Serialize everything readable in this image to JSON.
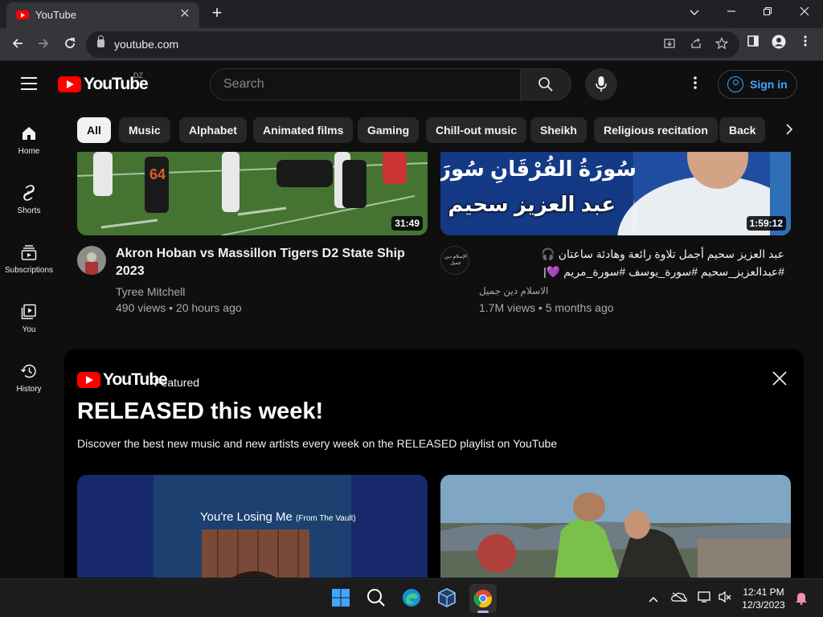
{
  "browser": {
    "tab": {
      "title": "YouTube",
      "favicon": "youtube-favicon"
    },
    "url": "youtube.com"
  },
  "masthead": {
    "logo_text": "YouTube",
    "country_code": "DZ",
    "search_placeholder": "Search",
    "signin_label": "Sign in"
  },
  "guide": {
    "items": [
      {
        "label": "Home",
        "icon": "home-icon"
      },
      {
        "label": "Shorts",
        "icon": "shorts-icon"
      },
      {
        "label": "Subscriptions",
        "icon": "subscriptions-icon"
      },
      {
        "label": "You",
        "icon": "you-icon"
      },
      {
        "label": "History",
        "icon": "history-icon"
      }
    ]
  },
  "chips": [
    "All",
    "Music",
    "Alphabet",
    "Animated films",
    "Gaming",
    "Chill-out music",
    "Sheikh",
    "Religious recitation",
    "Back"
  ],
  "videos": [
    {
      "title_line1": "Akron Hoban vs Massillon Tigers D2 State Ship",
      "title_line2": "2023",
      "channel": "Tyree Mitchell",
      "meta": "490 views • 20 hours ago",
      "duration": "31:49"
    },
    {
      "title_line1": "عبد العزيز سحيم أجمل تلاوة رائعة وهادئة ساعتان 🎧",
      "title_line2": "#عبدالعزيز_سحيم #سورة_يوسف #سورة_مريم 💜|",
      "channel": "الاسلام دين جميل",
      "meta": "1.7M views • 5 months ago",
      "duration": "1:59:12",
      "thumb_text_top": "سُورَةُ الفُرْقَانِ سُورَةُ القِيَامَةِ",
      "thumb_text_bottom": "عبد العزيز سحيم",
      "avatar_text": "الإسلام دين جميل"
    }
  ],
  "featured": {
    "logo_text": "YouTube",
    "tag": "Featured",
    "title": "RELEASED this week!",
    "description": "Discover the best new music and new artists every week on the RELEASED playlist on YouTube",
    "card1_text": "You're Losing Me",
    "card1_subtext": "(From The Vault)"
  },
  "taskbar": {
    "time": "12:41 PM",
    "date": "12/3/2023"
  },
  "colors": {
    "background": "#0f0f0f",
    "brand_red": "#ff0000",
    "link_blue": "#3ea6ff"
  }
}
